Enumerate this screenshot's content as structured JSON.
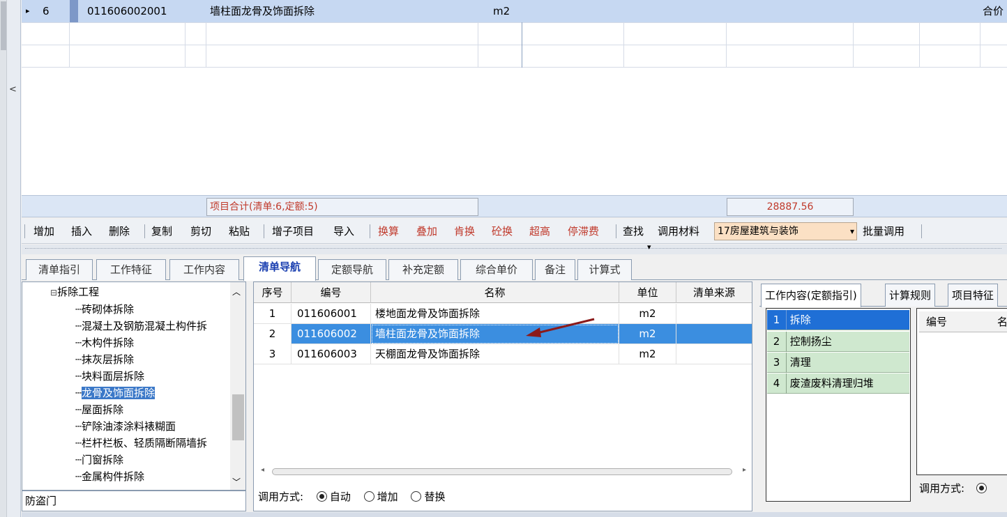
{
  "top_grid": {
    "row": {
      "indicator": "▸",
      "index": "6",
      "code": "011606002001",
      "name": "墙柱面龙骨及饰面拆除",
      "unit": "m2",
      "tail": "合价"
    },
    "summary_label": "项目合计(清单:6,定额:5)",
    "summary_total": "28887.56"
  },
  "toolbar": {
    "items": [
      "增加",
      "插入",
      "删除",
      "复制",
      "剪切",
      "粘贴",
      "增子项目",
      "导入",
      "换算",
      "叠加",
      "肯换",
      "砼换",
      "超高",
      "停滞费",
      "查找",
      "调用材料"
    ],
    "select_value": "17房屋建筑与装饰",
    "batch": "批量调用"
  },
  "tabs": [
    "清单指引",
    "工作特征",
    "工作内容",
    "清单导航",
    "定额导航",
    "补充定额",
    "综合单价",
    "备注",
    "计算式"
  ],
  "tree": {
    "root": "拆除工程",
    "items": [
      "砖砌体拆除",
      "混凝土及钢筋混凝土构件拆",
      "木构件拆除",
      "抹灰层拆除",
      "块料面层拆除",
      "龙骨及饰面拆除",
      "屋面拆除",
      "铲除油漆涂料裱糊面",
      "栏杆栏板、轻质隔断隔墙拆",
      "门窗拆除",
      "金属构件拆除"
    ],
    "footer": "防盗门"
  },
  "list": {
    "headers": [
      "序号",
      "编号",
      "名称",
      "单位",
      "清单来源"
    ],
    "rows": [
      {
        "no": "1",
        "code": "011606001",
        "name": "楼地面龙骨及饰面拆除",
        "unit": "m2",
        "src": ""
      },
      {
        "no": "2",
        "code": "011606002",
        "name": "墙柱面龙骨及饰面拆除",
        "unit": "m2",
        "src": ""
      },
      {
        "no": "3",
        "code": "011606003",
        "name": "天棚面龙骨及饰面拆除",
        "unit": "m2",
        "src": ""
      }
    ],
    "mode_label": "调用方式:",
    "mode_options": [
      "自动",
      "增加",
      "替换"
    ]
  },
  "right": {
    "tabs": [
      "工作内容(定额指引)",
      "计算规则",
      "项目特征"
    ],
    "work_items": [
      {
        "no": "1",
        "label": "拆除"
      },
      {
        "no": "2",
        "label": "控制扬尘"
      },
      {
        "no": "3",
        "label": "清理"
      },
      {
        "no": "4",
        "label": "废渣废料清理归堆"
      }
    ],
    "code_header": "编号",
    "code_header2": "名",
    "mode_label": "调用方式:"
  }
}
